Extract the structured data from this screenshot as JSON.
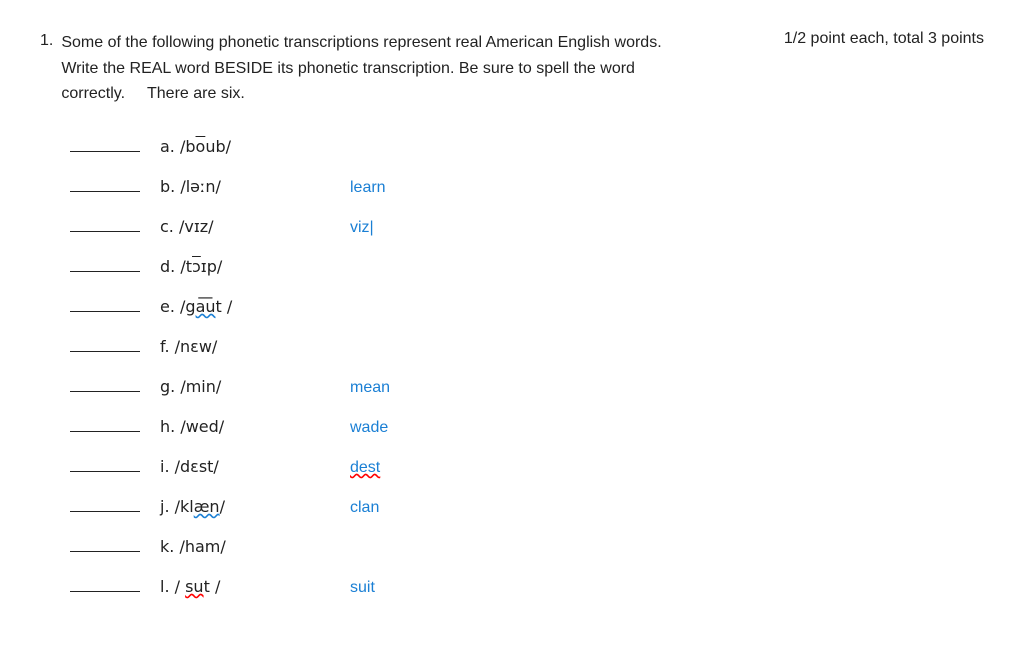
{
  "question": {
    "number": "1.",
    "text_line1": "Some of the following phonetic transcriptions represent real American English words.",
    "text_line2": "Write the REAL word BESIDE its phonetic transcription. Be sure to spell the word",
    "text_line3_left": "correctly.",
    "text_line3_middle": "There are six.",
    "text_line3_right": "1/2 point each, total 3 points"
  },
  "items": [
    {
      "id": "a",
      "ipa": "/bo̅ub/",
      "answer": "",
      "has_cursor": false
    },
    {
      "id": "b",
      "ipa": "/ləːn/",
      "answer": "learn",
      "has_cursor": false
    },
    {
      "id": "c",
      "ipa": "/vɪz/",
      "answer": "viz",
      "has_cursor": true
    },
    {
      "id": "d",
      "ipa": "/tɔɪp/",
      "answer": "",
      "has_cursor": false
    },
    {
      "id": "e",
      "ipa": "/ga͞ut /",
      "answer": "",
      "has_cursor": false
    },
    {
      "id": "f",
      "ipa": "/nɛw/",
      "answer": "",
      "has_cursor": false
    },
    {
      "id": "g",
      "ipa": "/min/",
      "answer": "mean",
      "has_cursor": false
    },
    {
      "id": "h",
      "ipa": "/wed/",
      "answer": "wade",
      "has_cursor": false
    },
    {
      "id": "i",
      "ipa": "/dɛst/",
      "answer": "dest",
      "has_cursor": false,
      "answer_wavy": true
    },
    {
      "id": "j",
      "ipa": "/klæn/",
      "answer": "clan",
      "has_cursor": false,
      "ipa_wavy": true
    },
    {
      "id": "k",
      "ipa": "/ham/",
      "answer": "",
      "has_cursor": false
    },
    {
      "id": "l",
      "ipa": "/ sut /",
      "answer": "suit",
      "has_cursor": false,
      "answer_wavy_red": false
    }
  ],
  "colors": {
    "answer_blue": "#1a7fd4",
    "wavy_red": "#cc0000"
  }
}
